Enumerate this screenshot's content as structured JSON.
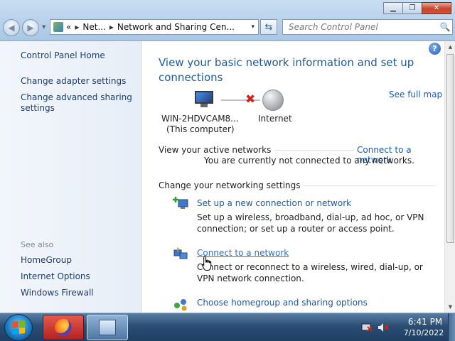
{
  "window": {
    "minimize_glyph": "▁",
    "maximize_glyph": "❐",
    "close_glyph": "✕"
  },
  "address_bar": {
    "overflow": "«",
    "crumbs": [
      "Net...",
      "Network and Sharing Cen..."
    ],
    "separator": "▸",
    "caret": "▾",
    "refresh_glyph": "⇆"
  },
  "search": {
    "placeholder": "Search Control Panel",
    "icon": "🔍"
  },
  "left_nav": {
    "home": "Control Panel Home",
    "links": [
      "Change adapter settings",
      "Change advanced sharing settings"
    ],
    "see_also_title": "See also",
    "see_also": [
      "HomeGroup",
      "Internet Options",
      "Windows Firewall"
    ]
  },
  "main": {
    "help": "?",
    "heading": "View your basic network information and set up connections",
    "see_full_map": "See full map",
    "computer_name": "WIN-2HDVCAM8...",
    "computer_sub": "(This computer)",
    "internet_label": "Internet",
    "broken_link_glyph": "✖",
    "active_networks_title": "View your active networks",
    "connect_to_network_link": "Connect to a network",
    "not_connected": "You are currently not connected to any networks.",
    "change_settings_title": "Change your networking settings",
    "tasks": [
      {
        "icon": "new-connection-icon",
        "link": "Set up a new connection or network",
        "desc": "Set up a wireless, broadband, dial-up, ad hoc, or VPN connection; or set up a router or access point."
      },
      {
        "icon": "connect-network-icon",
        "link": "Connect to a network",
        "desc": "Connect or reconnect to a wireless, wired, dial-up, or VPN network connection."
      },
      {
        "icon": "homegroup-icon",
        "link": "Choose homegroup and sharing options",
        "desc": ""
      }
    ]
  },
  "taskbar": {
    "time": "6:41 PM",
    "date": "7/10/2022"
  },
  "colors": {
    "link": "#1c5aa8",
    "heading": "#1e5c99",
    "nav_link": "#1c3d6e"
  }
}
